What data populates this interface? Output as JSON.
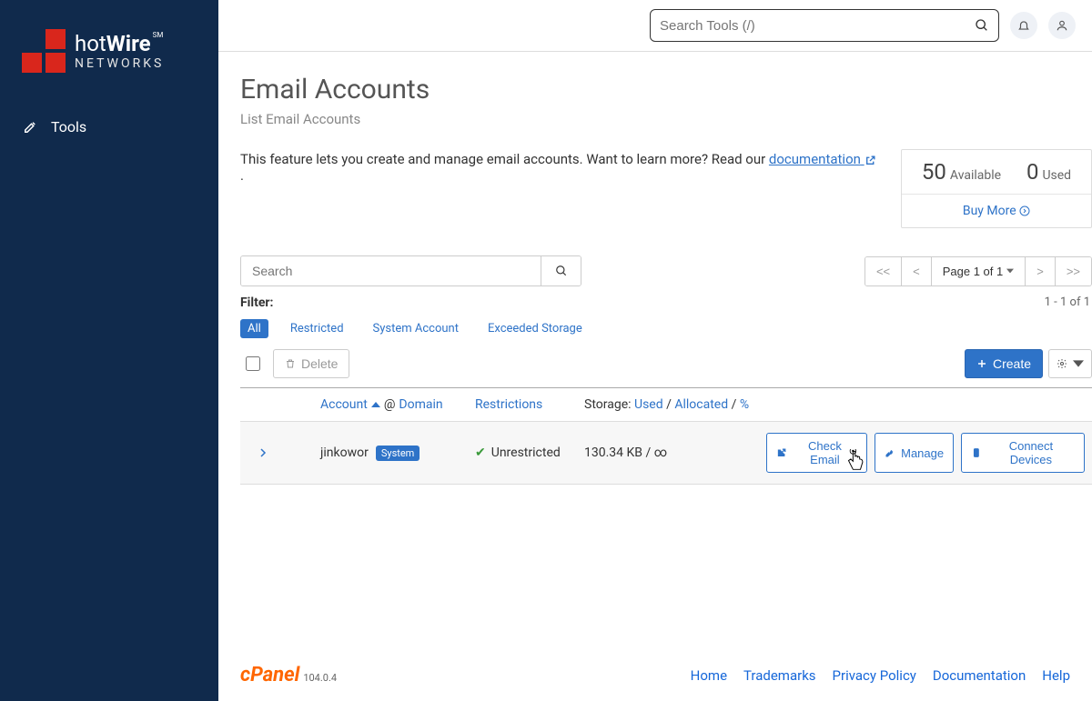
{
  "sidebar": {
    "brand_line1a": "hot",
    "brand_line1b": "Wire",
    "brand_line2": "NETWORKS",
    "tools_label": "Tools"
  },
  "topbar": {
    "search_placeholder": "Search Tools (/)"
  },
  "page": {
    "title": "Email Accounts",
    "subtitle": "List Email Accounts",
    "intro_prefix": "This feature lets you create and manage email accounts. Want to learn more? Read our ",
    "intro_link": "documentation",
    "intro_suffix": " ."
  },
  "stats": {
    "available_num": "50",
    "available_label": "Available",
    "used_num": "0",
    "used_label": "Used",
    "buy_more": "Buy More"
  },
  "list": {
    "search_placeholder": "Search",
    "pager_first": "<<",
    "pager_prev": "<",
    "pager_current": "Page 1 of 1",
    "pager_next": ">",
    "pager_last": ">>",
    "filter_label": "Filter:",
    "filters": {
      "all": "All",
      "restricted": "Restricted",
      "system": "System Account",
      "exceeded": "Exceeded Storage"
    },
    "range": "1 - 1 of 1",
    "delete_label": "Delete",
    "create_label": "Create",
    "headers": {
      "account": "Account",
      "at": "@",
      "domain": "Domain",
      "restrictions": "Restrictions",
      "storage_prefix": "Storage:",
      "used": "Used",
      "allocated": "Allocated",
      "percent": "%"
    },
    "row": {
      "account": "jinkowor",
      "system_badge": "System",
      "restriction": "Unrestricted",
      "storage": "130.34 KB / ∞",
      "check_email": "Check Email",
      "manage": "Manage",
      "connect": "Connect Devices"
    }
  },
  "footer": {
    "cpanel": "cPanel",
    "version": "104.0.4",
    "links": {
      "home": "Home",
      "trademarks": "Trademarks",
      "privacy": "Privacy Policy",
      "docs": "Documentation",
      "help": "Help"
    }
  }
}
